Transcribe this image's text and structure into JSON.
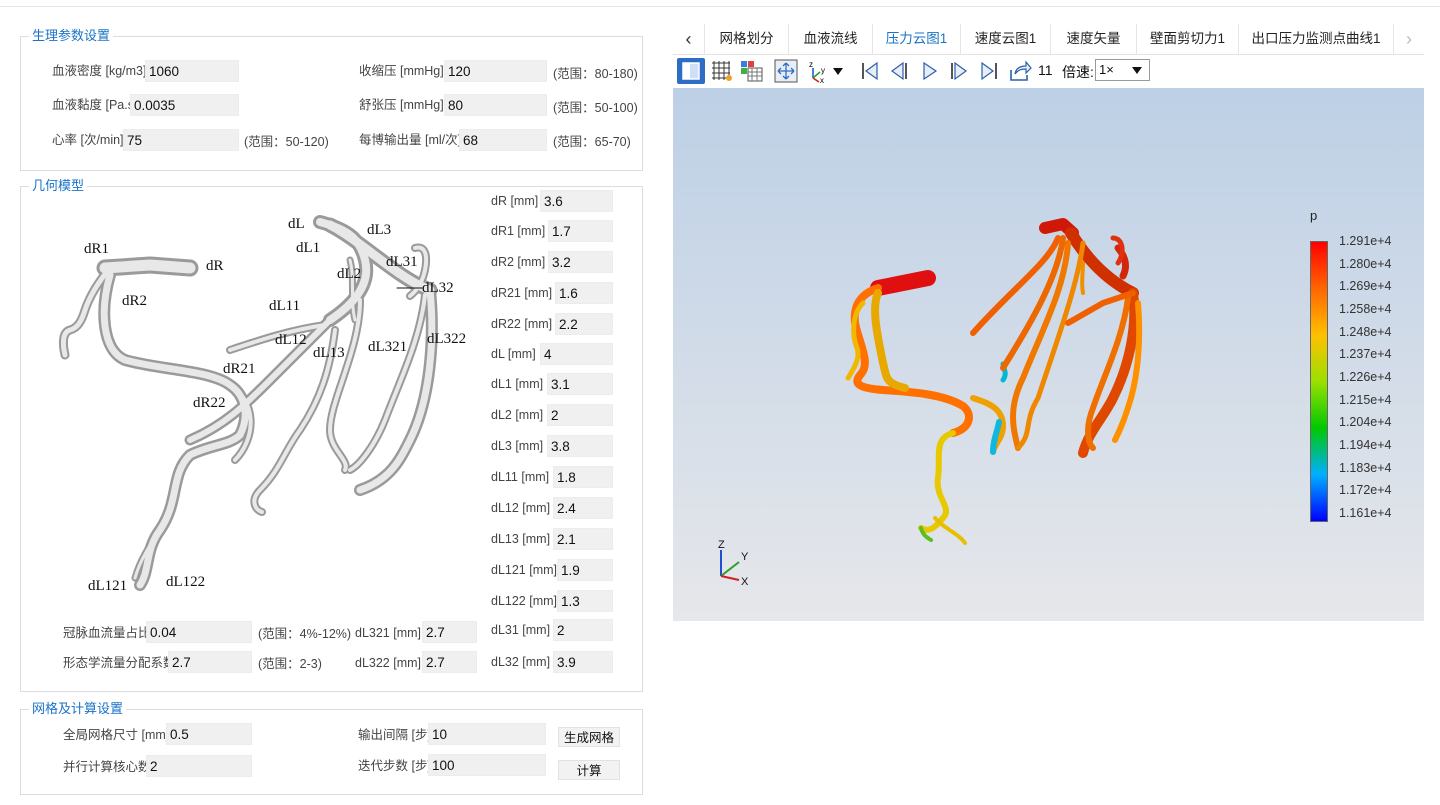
{
  "physio": {
    "title": "生理参数设置",
    "blood_density": {
      "label": "血液密度 [kg/m3]",
      "value": "1060"
    },
    "blood_viscosity": {
      "label": "血液黏度 [Pa.s]",
      "value": "0.0035"
    },
    "heart_rate": {
      "label": "心率 [次/min]",
      "value": "75",
      "range": "(范围：50-120)"
    },
    "systolic": {
      "label": "收缩压 [mmHg]",
      "value": "120",
      "range": "(范围：80-180)"
    },
    "diastolic": {
      "label": "舒张压 [mmHg]",
      "value": "80",
      "range": "(范围：50-100)"
    },
    "stroke_volume": {
      "label": "每博输出量 [ml/次]",
      "value": "68",
      "range": "(范围：65-70)"
    }
  },
  "geometry": {
    "title": "几何模型",
    "model_labels": [
      "dR1",
      "dR",
      "dR2",
      "dL",
      "dL3",
      "dL1",
      "dL31",
      "dL2",
      "dL32",
      "dL11",
      "dL12",
      "dL13",
      "dL321",
      "dL322",
      "dR21",
      "dR22",
      "dL121",
      "dL122"
    ],
    "params": [
      {
        "label": "dR [mm]",
        "value": "3.6"
      },
      {
        "label": "dR1 [mm]",
        "value": "1.7"
      },
      {
        "label": "dR2 [mm]",
        "value": "3.2"
      },
      {
        "label": "dR21 [mm]",
        "value": "1.6"
      },
      {
        "label": "dR22 [mm]",
        "value": "2.2"
      },
      {
        "label": "dL [mm]",
        "value": "4"
      },
      {
        "label": "dL1 [mm]",
        "value": "3.1"
      },
      {
        "label": "dL2 [mm]",
        "value": "2"
      },
      {
        "label": "dL3 [mm]",
        "value": "3.8"
      },
      {
        "label": "dL11 [mm]",
        "value": "1.8"
      },
      {
        "label": "dL12 [mm]",
        "value": "2.4"
      },
      {
        "label": "dL13 [mm]",
        "value": "2.1"
      },
      {
        "label": "dL121 [mm]",
        "value": "1.9"
      },
      {
        "label": "dL122 [mm]",
        "value": "1.3"
      },
      {
        "label": "dL31 [mm]",
        "value": "2"
      },
      {
        "label": "dL32 [mm]",
        "value": "3.9"
      }
    ],
    "coronary_ratio": {
      "label": "冠脉血流量占比",
      "value": "0.04",
      "range": "(范围：4%-12%)"
    },
    "morph_coef": {
      "label": "形态学流量分配系数",
      "value": "2.7",
      "range": "(范围：2-3)"
    },
    "dL321": {
      "label": "dL321 [mm]",
      "value": "2.7"
    },
    "dL322": {
      "label": "dL322 [mm]",
      "value": "2.7"
    }
  },
  "mesh": {
    "title": "网格及计算设置",
    "global_size": {
      "label": "全局网格尺寸 [mm]",
      "value": "0.5"
    },
    "cores": {
      "label": "并行计算核心数",
      "value": "2"
    },
    "output_interval": {
      "label": "输出间隔 [步]",
      "value": "10"
    },
    "iterations": {
      "label": "迭代步数 [步]",
      "value": "100"
    },
    "gen_mesh_button": "生成网格",
    "compute_button": "计算"
  },
  "tabs": {
    "prev": "‹",
    "next": "›",
    "items": [
      "网格划分",
      "血液流线",
      "压力云图1",
      "速度云图1",
      "速度矢量",
      "壁面剪切力1",
      "出口压力监测点曲线1"
    ],
    "active": "压力云图1"
  },
  "toolbar": {
    "frame": "11",
    "speed_label": "倍速:",
    "speed_value": "1×"
  },
  "viewer": {
    "colorbar_title": "p",
    "colorbar_labels": [
      "1.291e+4",
      "1.280e+4",
      "1.269e+4",
      "1.258e+4",
      "1.248e+4",
      "1.237e+4",
      "1.226e+4",
      "1.215e+4",
      "1.204e+4",
      "1.194e+4",
      "1.183e+4",
      "1.172e+4",
      "1.161e+4"
    ],
    "colorbar_colors": [
      "#ff0000",
      "#ff6600",
      "#ffc000",
      "#9be000",
      "#00c800",
      "#00b0ff",
      "#0000ff"
    ],
    "axes": {
      "z": "Z",
      "y": "Y",
      "x": "X"
    }
  },
  "icons": [
    "toggle-view-icon",
    "mesh-grid-icon",
    "color-map-icon",
    "fit-view-icon",
    "axis-orientation-icon",
    "first-frame-icon",
    "prev-frame-icon",
    "play-icon",
    "next-frame-icon",
    "last-frame-icon",
    "export-icon",
    "dropdown-arrow-icon"
  ]
}
